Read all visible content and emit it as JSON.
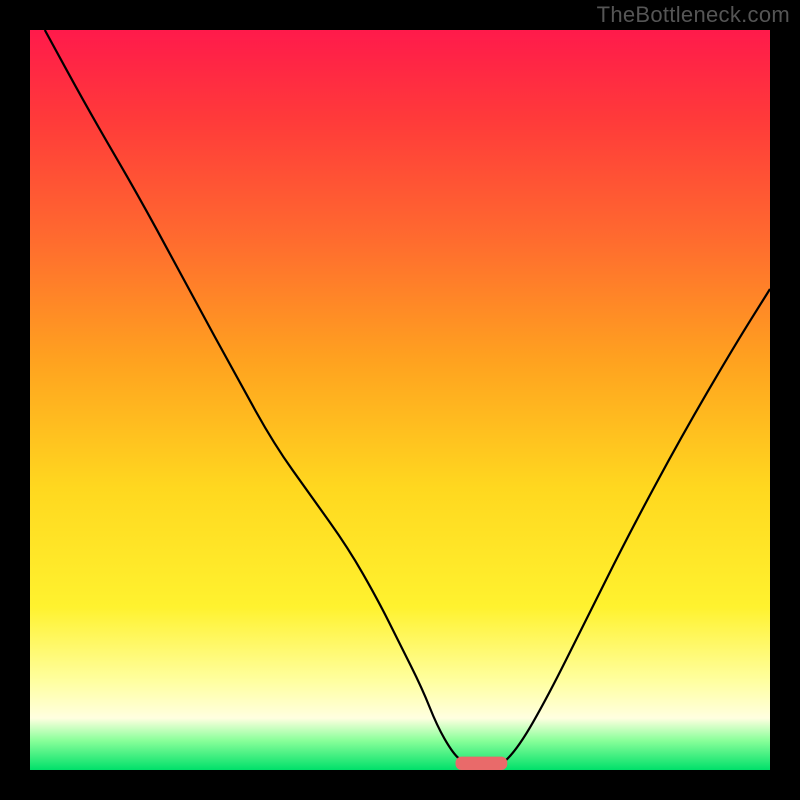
{
  "watermark": "TheBottleneck.com",
  "chart_data": {
    "type": "line",
    "title": "",
    "xlabel": "",
    "ylabel": "",
    "xlim": [
      0,
      100
    ],
    "ylim": [
      0,
      100
    ],
    "grid": false,
    "legend": false,
    "background_gradient_stops": [
      {
        "offset": 0.0,
        "color": "#ff1a4b"
      },
      {
        "offset": 0.12,
        "color": "#ff3a3a"
      },
      {
        "offset": 0.28,
        "color": "#ff6a2f"
      },
      {
        "offset": 0.45,
        "color": "#ffa31f"
      },
      {
        "offset": 0.62,
        "color": "#ffd81f"
      },
      {
        "offset": 0.78,
        "color": "#fff22f"
      },
      {
        "offset": 0.88,
        "color": "#ffffa0"
      },
      {
        "offset": 0.93,
        "color": "#ffffe0"
      },
      {
        "offset": 0.96,
        "color": "#8aff9a"
      },
      {
        "offset": 1.0,
        "color": "#00e06a"
      }
    ],
    "series": [
      {
        "name": "bottleneck-curve",
        "type": "line",
        "color": "#000000",
        "x": [
          2,
          8,
          15,
          22,
          28,
          33,
          38,
          43,
          47,
          50,
          53,
          55,
          57,
          58.5,
          60,
          63,
          66,
          70,
          75,
          81,
          88,
          95,
          100
        ],
        "y": [
          100,
          89,
          77,
          64,
          53,
          44,
          37,
          30,
          23,
          17,
          11,
          6,
          2.5,
          1,
          0,
          0,
          3,
          10,
          20,
          32,
          45,
          57,
          65
        ]
      }
    ],
    "marker": {
      "name": "optimal-marker",
      "shape": "rounded-bar",
      "color": "#e96a6a",
      "x_center": 61,
      "y": 0,
      "width_x_units": 7,
      "height_y_units": 2
    }
  }
}
